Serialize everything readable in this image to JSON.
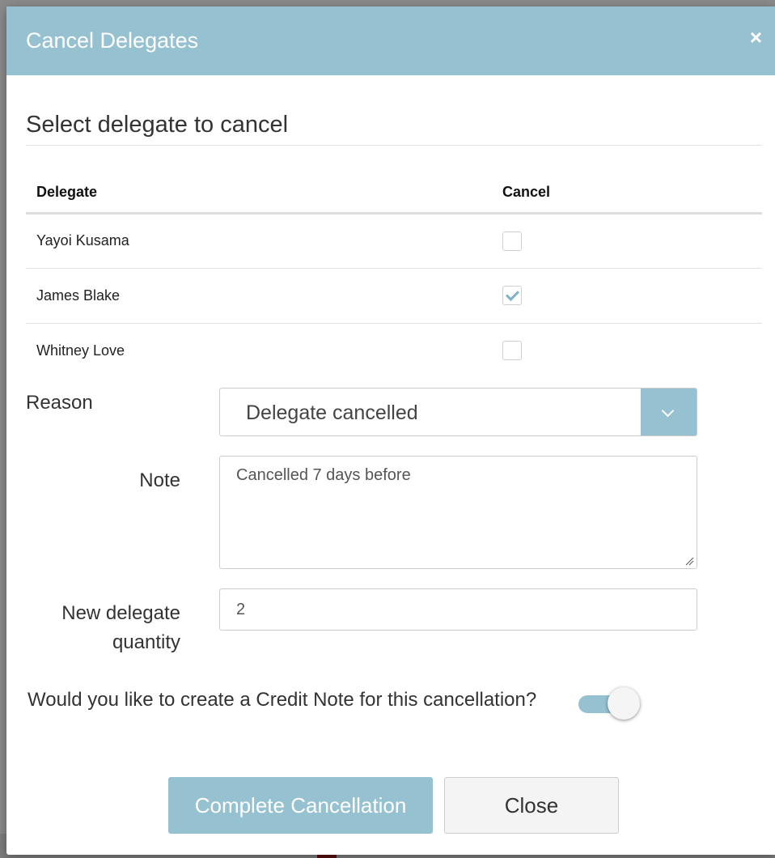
{
  "modal": {
    "title": "Cancel Delegates",
    "close_glyph": "×"
  },
  "section": {
    "title": "Select delegate to cancel"
  },
  "table": {
    "headers": {
      "delegate": "Delegate",
      "cancel": "Cancel"
    },
    "rows": [
      {
        "name": "Yayoi Kusama",
        "cancel": false
      },
      {
        "name": "James Blake",
        "cancel": true
      },
      {
        "name": "Whitney Love",
        "cancel": false
      }
    ]
  },
  "form": {
    "reason_label": "Reason",
    "reason_value": "Delegate cancelled",
    "note_label": "Note",
    "note_value": "Cancelled 7 days before",
    "qty_label_line1": "New delegate",
    "qty_label_line2": "quantity",
    "qty_value": "2",
    "credit_question": "Would you like to create a Credit Note for this cancellation?",
    "credit_note_enabled": true
  },
  "buttons": {
    "complete": "Complete Cancellation",
    "close": "Close"
  },
  "colors": {
    "accent": "#96c1d1",
    "check": "#7fb2c5"
  },
  "icons": {
    "close": "close-icon",
    "dropdown": "chevron-down-icon",
    "check": "checkmark-icon",
    "resize": "resize-grip-icon"
  }
}
